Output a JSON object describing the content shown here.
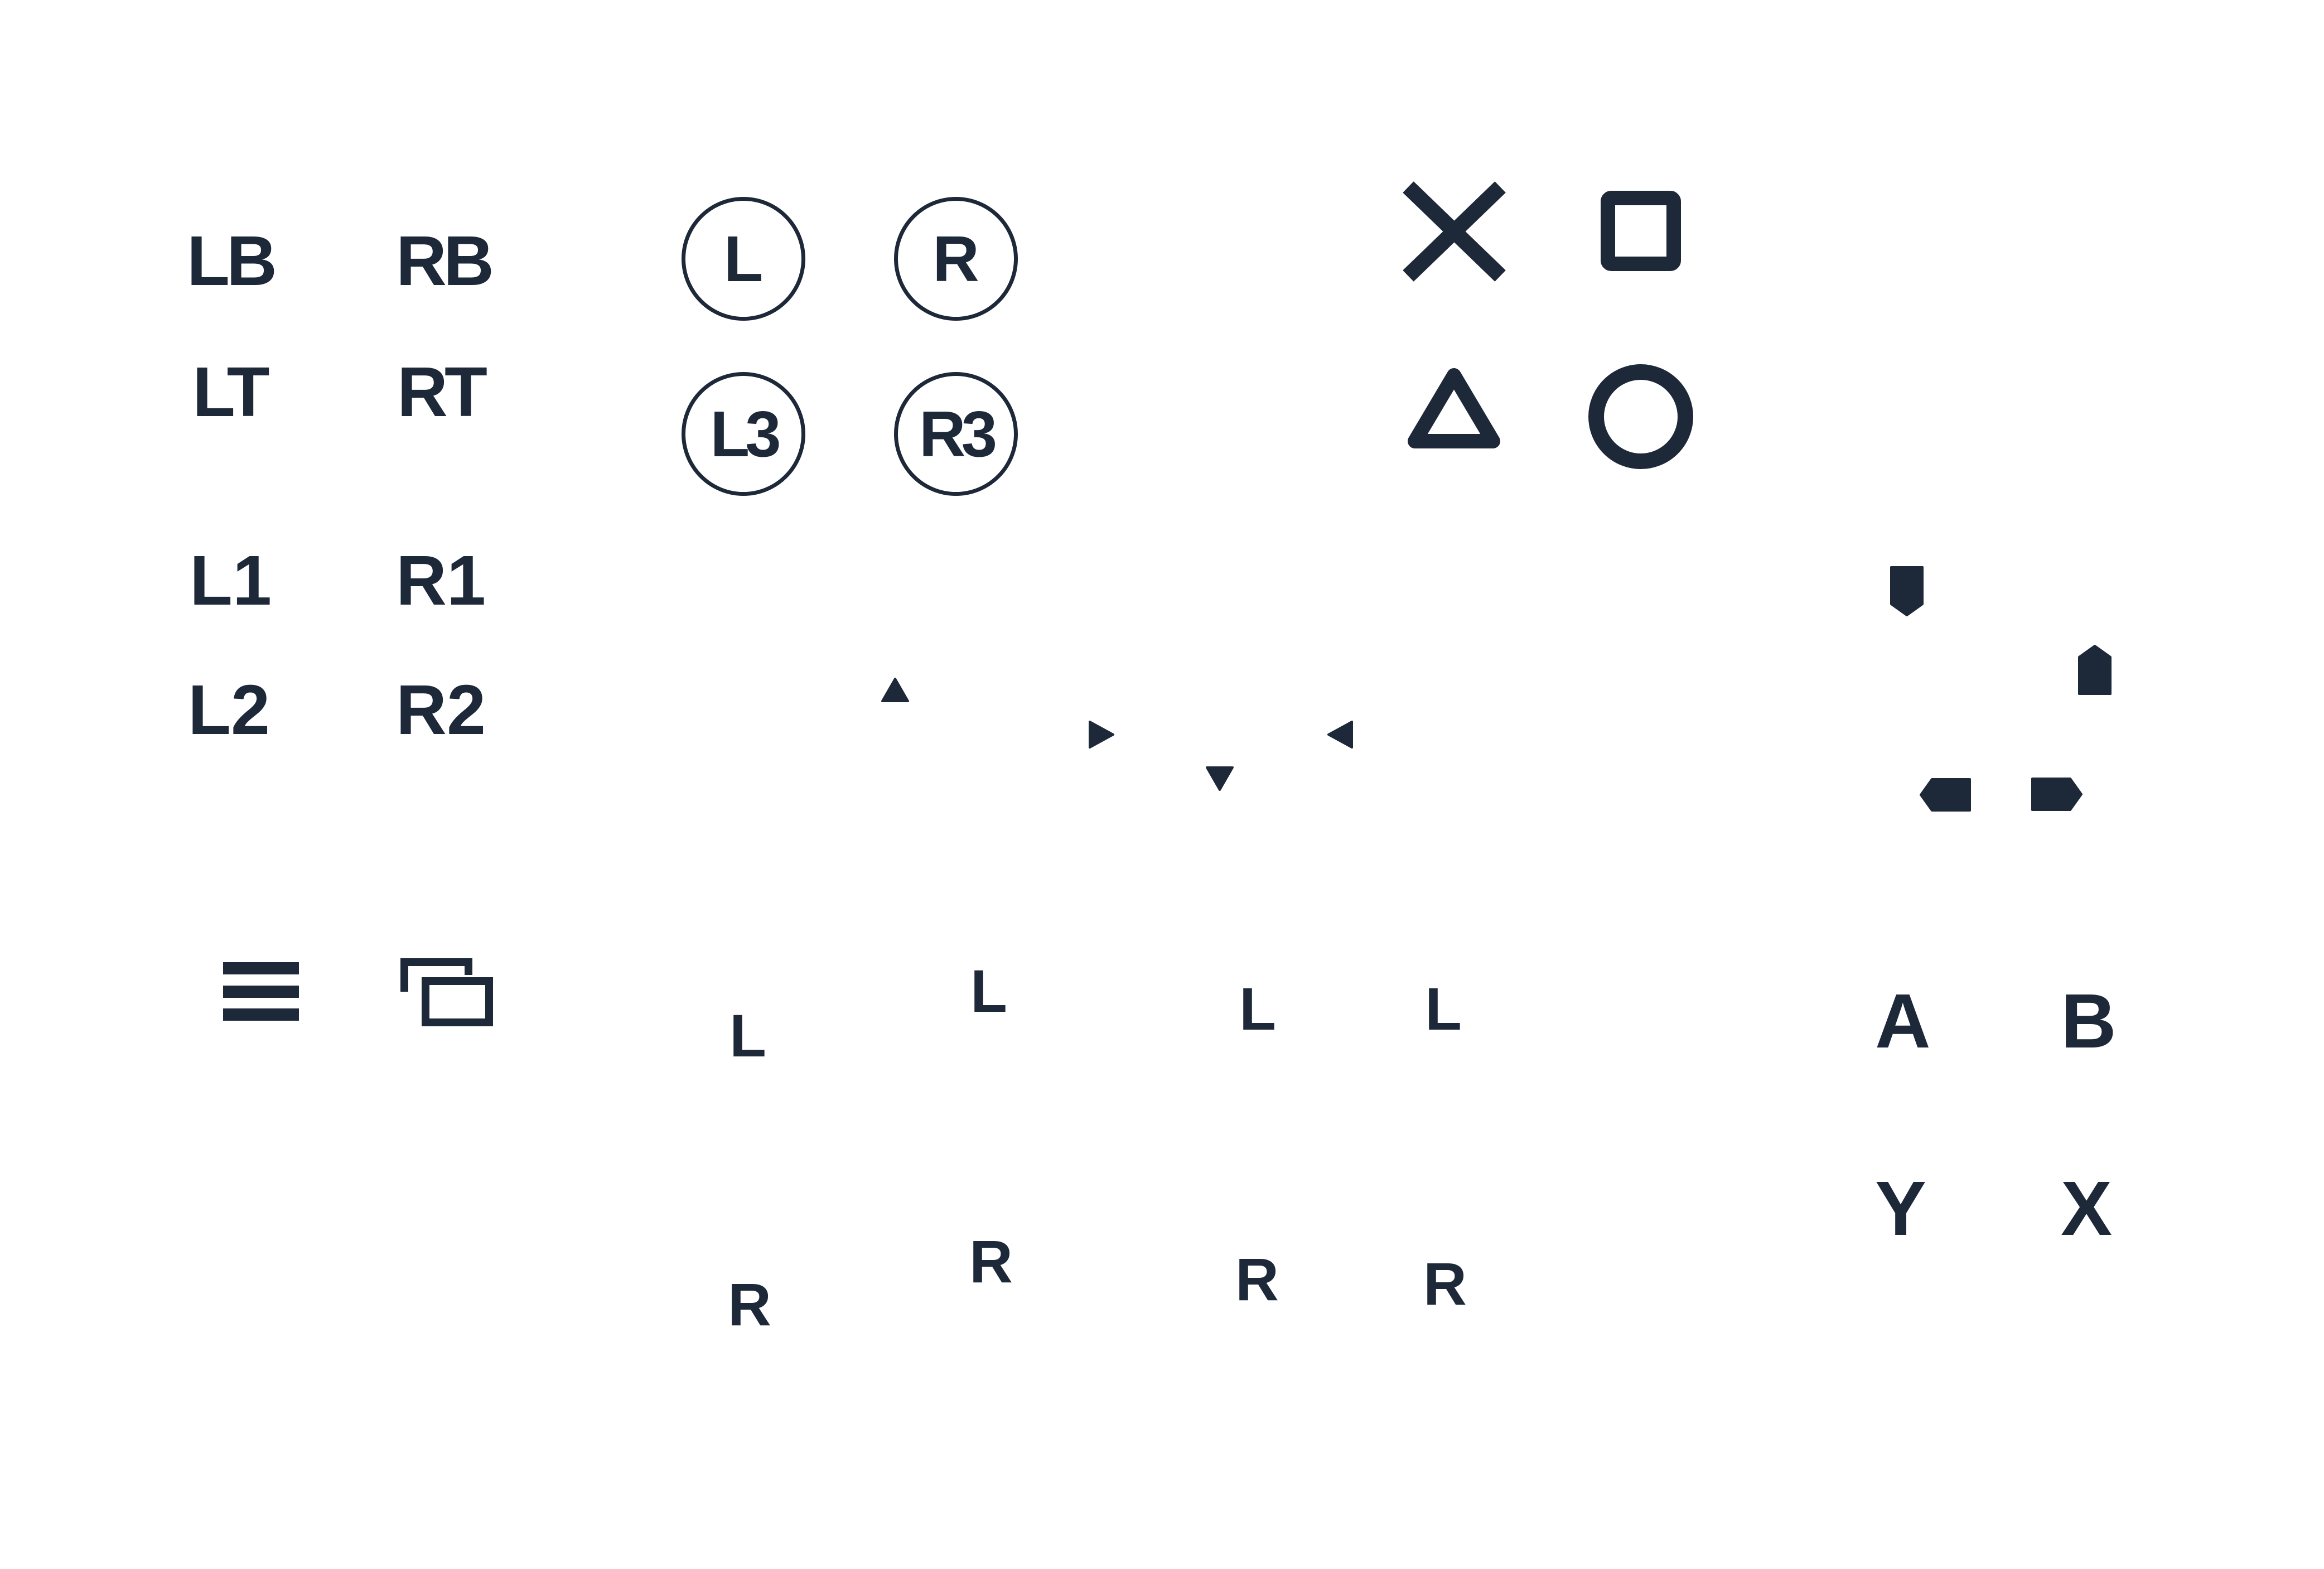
{
  "ink_color": "#1d2839",
  "background_color": "#ffffff",
  "bumper_trigger_labels": {
    "lb": "LB",
    "rb": "RB",
    "lt": "LT",
    "rt": "RT",
    "l1": "L1",
    "r1": "R1",
    "l2": "L2",
    "r2": "R2"
  },
  "stick_buttons": {
    "l": "L",
    "r": "R",
    "l3": "L3",
    "r3": "R3"
  },
  "playstation_face_buttons": [
    "cross-icon",
    "square-icon",
    "triangle-icon",
    "circle-icon"
  ],
  "dpad_arrows": [
    "arrow-up-icon",
    "arrow-right-icon",
    "arrow-down-icon",
    "arrow-left-icon"
  ],
  "dpad_pointers": [
    "pointer-down-icon",
    "pointer-up-icon",
    "pointer-left-icon",
    "pointer-right-icon"
  ],
  "system_icons": [
    "menu-icon",
    "view-icon"
  ],
  "stick_direction_labels": {
    "left": [
      "L",
      "L",
      "L",
      "L"
    ],
    "right": [
      "R",
      "R",
      "R",
      "R"
    ]
  },
  "xbox_face_buttons": {
    "a": "A",
    "b": "B",
    "y": "Y",
    "x": "X"
  }
}
